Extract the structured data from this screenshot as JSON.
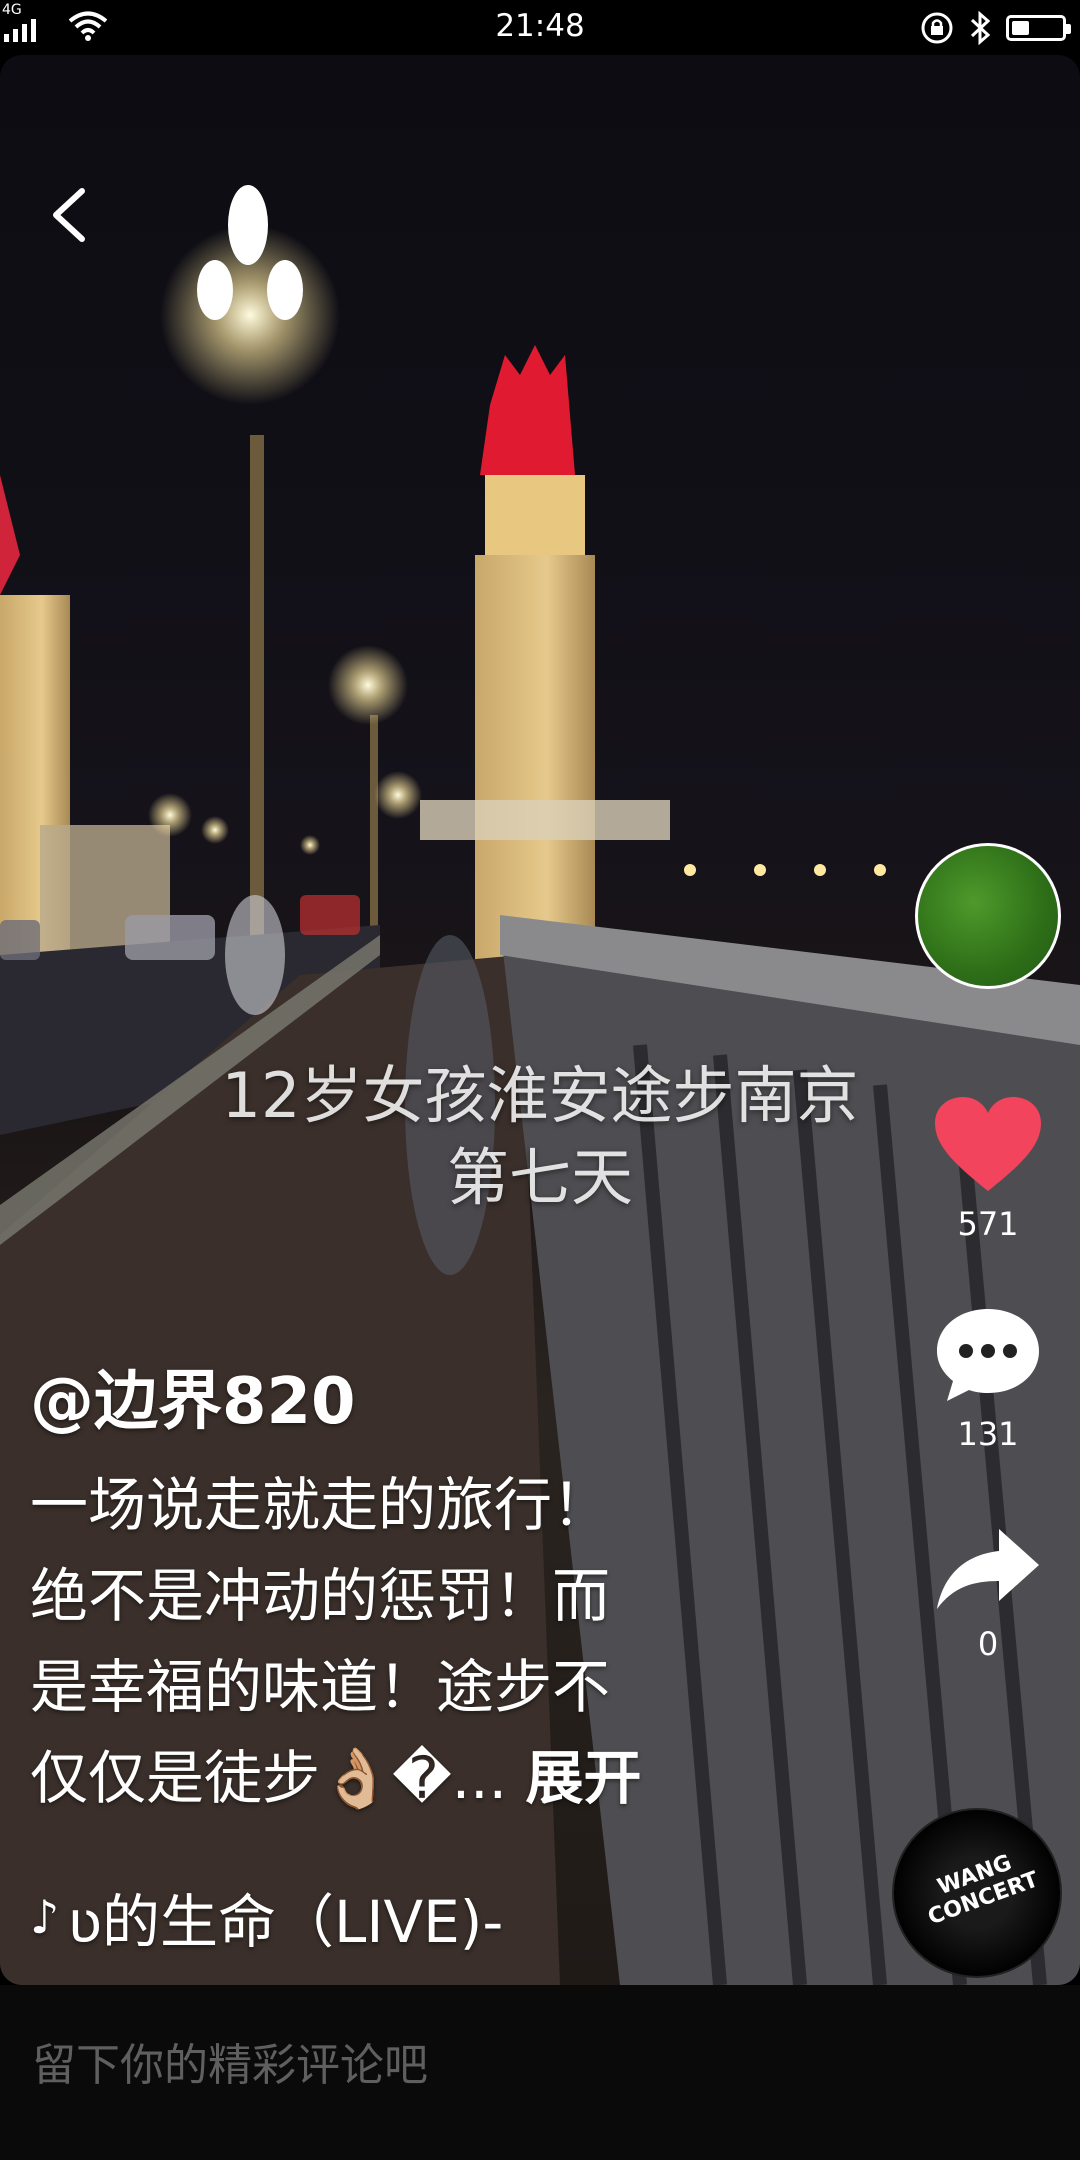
{
  "status_bar": {
    "network": "4G",
    "time": "21:48",
    "battery_level": 0.35
  },
  "video": {
    "overlay_title_line1": "12岁女孩淮安途步南京",
    "overlay_title_line2": "第七天"
  },
  "author": {
    "username": "@边界820"
  },
  "caption": {
    "line1": "一场说走就走的旅行！",
    "line2": "绝不是冲动的惩罚！而",
    "line3": "是幸福的味道！途步不",
    "line4": "仅仅是徒步👌🏼�...",
    "expand_label": "展开"
  },
  "music": {
    "title": "ʋ的生命（LIVE)-",
    "icon": "music-note-icon"
  },
  "actions": {
    "like_count": "571",
    "comment_count": "131",
    "share_count": "0",
    "like_color": "#f2445c"
  },
  "disc": {
    "label": "WANG CONCERT"
  },
  "comment_bar": {
    "placeholder": "留下你的精彩评论吧"
  }
}
